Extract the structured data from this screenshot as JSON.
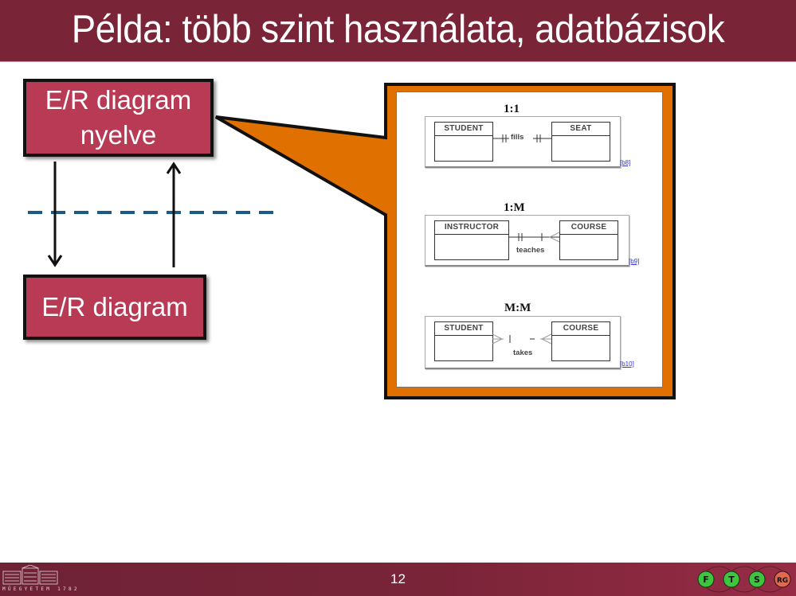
{
  "slide": {
    "title": "Példa: több szint használata, adatbázisok",
    "page_number": "12"
  },
  "left_diagram": {
    "top_box": {
      "line1": "E/R diagram",
      "line2": "nyelve"
    },
    "bottom_box": {
      "label": "E/R diagram"
    },
    "arrows": [
      {
        "from": "top_box",
        "to": "bottom_box",
        "direction": "down"
      },
      {
        "from": "bottom_box",
        "to": "top_box",
        "direction": "up"
      }
    ],
    "separator": "dashed-line"
  },
  "callout": {
    "panels": [
      {
        "title": "1:1",
        "left_entity": "STUDENT",
        "right_entity": "SEAT",
        "relationship": "fills",
        "reference": "[b8]"
      },
      {
        "title": "1:M",
        "left_entity": "INSTRUCTOR",
        "right_entity": "COURSE",
        "relationship": "teaches",
        "reference": "[b9]"
      },
      {
        "title": "M:M",
        "left_entity": "STUDENT",
        "right_entity": "COURSE",
        "relationship": "takes",
        "reference": "[b10]"
      }
    ]
  },
  "footer": {
    "left_logo_text": "MŰEGYETEM 1782",
    "right_logo_letters": [
      "F",
      "T",
      "S",
      "RG"
    ]
  },
  "colors": {
    "title_bar": "#7a2438",
    "box_fill": "#b93a55",
    "callout_fill": "#e07000",
    "separator": "#1f5a85"
  }
}
